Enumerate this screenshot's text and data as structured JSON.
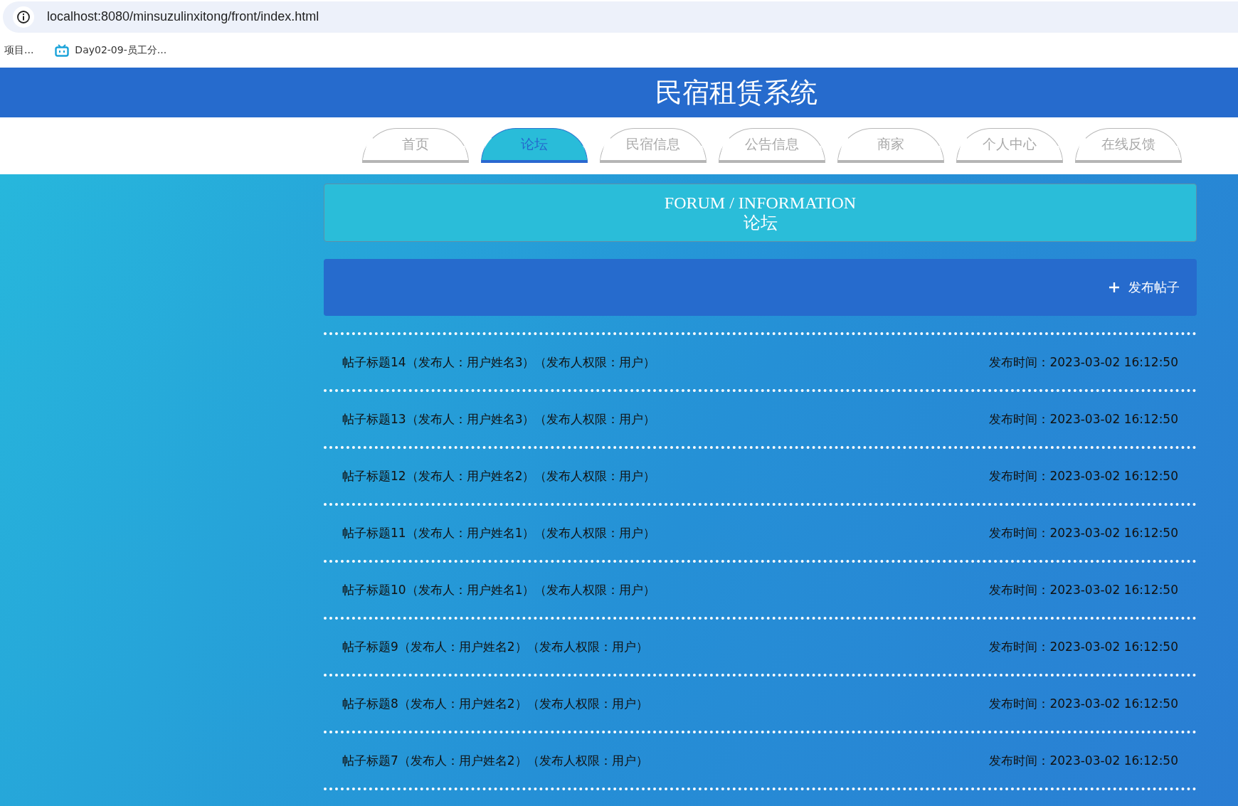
{
  "browser": {
    "url": "localhost:8080/minsuzulinxitong/front/index.html",
    "bookmarks": [
      "项目...",
      "Day02-09-员工分..."
    ]
  },
  "header": {
    "title": "民宿租赁系统"
  },
  "nav": [
    {
      "label": "首页",
      "selected": false
    },
    {
      "label": "论坛",
      "selected": true
    },
    {
      "label": "民宿信息",
      "selected": false
    },
    {
      "label": "公告信息",
      "selected": false
    },
    {
      "label": "商家",
      "selected": false
    },
    {
      "label": "个人中心",
      "selected": false
    },
    {
      "label": "在线反馈",
      "selected": false
    }
  ],
  "section": {
    "title_en": "FORUM / INFORMATION",
    "title_cn": "论坛"
  },
  "toolbar": {
    "add_button": "发布帖子"
  },
  "posts": [
    {
      "title": "帖子标题14（发布人：用户姓名3）（发布人权限：用户）",
      "time": "发布时间：2023-03-02 16:12:50"
    },
    {
      "title": "帖子标题13（发布人：用户姓名3）（发布人权限：用户）",
      "time": "发布时间：2023-03-02 16:12:50"
    },
    {
      "title": "帖子标题12（发布人：用户姓名2）（发布人权限：用户）",
      "time": "发布时间：2023-03-02 16:12:50"
    },
    {
      "title": "帖子标题11（发布人：用户姓名1）（发布人权限：用户）",
      "time": "发布时间：2023-03-02 16:12:50"
    },
    {
      "title": "帖子标题10（发布人：用户姓名1）（发布人权限：用户）",
      "time": "发布时间：2023-03-02 16:12:50"
    },
    {
      "title": "帖子标题9（发布人：用户姓名2）（发布人权限：用户）",
      "time": "发布时间：2023-03-02 16:12:50"
    },
    {
      "title": "帖子标题8（发布人：用户姓名2）（发布人权限：用户）",
      "time": "发布时间：2023-03-02 16:12:50"
    },
    {
      "title": "帖子标题7（发布人：用户姓名2）（发布人权限：用户）",
      "time": "发布时间：2023-03-02 16:12:50"
    }
  ]
}
